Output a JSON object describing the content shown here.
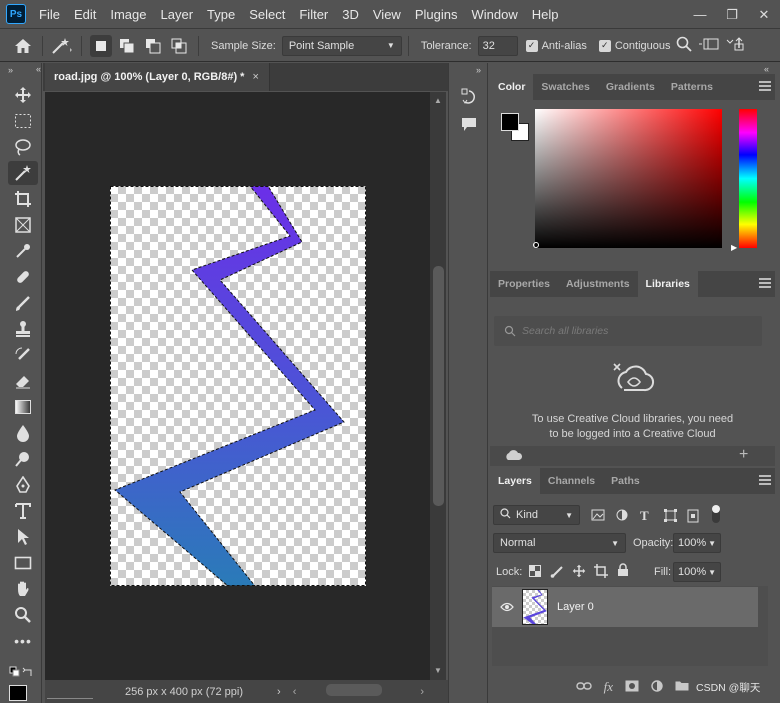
{
  "app": {
    "logo": "Ps"
  },
  "menu": [
    "File",
    "Edit",
    "Image",
    "Layer",
    "Type",
    "Select",
    "Filter",
    "3D",
    "View",
    "Plugins",
    "Window",
    "Help"
  ],
  "window_controls": {
    "minimize": "—",
    "restore": "❐",
    "close": "✕"
  },
  "options": {
    "sample_size_label": "Sample Size:",
    "sample_size_value": "Point Sample",
    "tolerance_label": "Tolerance:",
    "tolerance_value": "32",
    "antialias_label": "Anti-alias",
    "contiguous_label": "Contiguous"
  },
  "document": {
    "tab_title": "road.jpg @ 100% (Layer 0, RGB/8#) *",
    "status": "256 px x 400 px (72 ppi)",
    "zoom_field": ""
  },
  "color_panel": {
    "tabs": [
      "Color",
      "Swatches",
      "Gradients",
      "Patterns"
    ],
    "foreground": "#000000",
    "background": "#ffffff",
    "hue_color": "#ff0000"
  },
  "libraries_panel": {
    "tabs": [
      "Properties",
      "Adjustments",
      "Libraries"
    ],
    "search_placeholder": "Search all libraries",
    "message_line1": "To use Creative Cloud libraries, you need",
    "message_line2": "to be logged into a Creative Cloud"
  },
  "layers_panel": {
    "tabs": [
      "Layers",
      "Channels",
      "Paths"
    ],
    "filter_kind": "Kind",
    "blend_mode": "Normal",
    "opacity_label": "Opacity:",
    "opacity_value": "100%",
    "lock_label": "Lock:",
    "fill_label": "Fill:",
    "fill_value": "100%",
    "layers": [
      {
        "name": "Layer 0",
        "visible": true
      }
    ]
  },
  "watermark": "CSDN @聊天",
  "colors": {
    "panel": "#535353",
    "canvas": "#282828",
    "accent": "#31a8ff"
  }
}
